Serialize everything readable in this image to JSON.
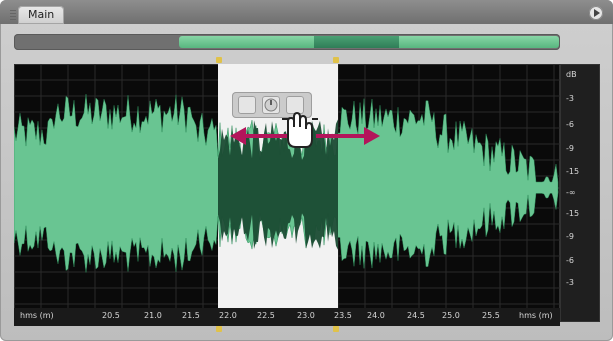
{
  "panel": {
    "tab_label": "Main"
  },
  "overview": {},
  "tools": {
    "items": [
      {
        "name": "envelope-tool-icon"
      },
      {
        "name": "dial-tool-icon"
      },
      {
        "name": "clip-tool-icon"
      }
    ]
  },
  "db_scale": {
    "labels": [
      "dB",
      "-3",
      "-6",
      "-9",
      "-15",
      "-∞",
      "-15",
      "-9",
      "-6",
      "-3"
    ]
  },
  "time_ruler": {
    "labels": [
      "hms (m)",
      "20.5",
      "21.0",
      "21.5",
      "22.0",
      "22.5",
      "23.0",
      "23.5",
      "24.0",
      "24.5",
      "25.0",
      "25.5",
      "hms (m)"
    ]
  },
  "colors": {
    "waveform": "#69c592",
    "waveform_selected": "#1a4b33",
    "selection_bg": "#f2f2f2",
    "display_bg": "#0a0a0a",
    "arrow": "#b3155b",
    "marker": "#e0c24a"
  }
}
